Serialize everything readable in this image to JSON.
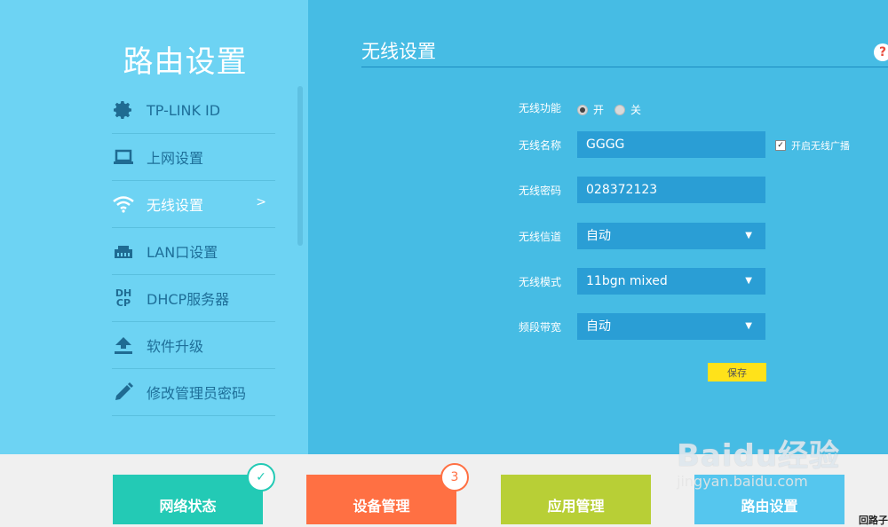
{
  "sidebar": {
    "title": "路由设置",
    "items": [
      {
        "label": "TP-LINK ID",
        "icon": "gear-icon"
      },
      {
        "label": "上网设置",
        "icon": "laptop-icon"
      },
      {
        "label": "无线设置",
        "icon": "wifi-icon",
        "active": true,
        "arrow": ">"
      },
      {
        "label": "LAN口设置",
        "icon": "lan-icon"
      },
      {
        "label": "DHCP服务器",
        "icon": "dhcp-icon",
        "icon_text": "DH CP"
      },
      {
        "label": "软件升级",
        "icon": "upload-icon"
      },
      {
        "label": "修改管理员密码",
        "icon": "pencil-icon"
      }
    ]
  },
  "main": {
    "title": "无线设置",
    "help": "?",
    "form": {
      "wireless_function": {
        "label": "无线功能",
        "on_label": "开",
        "off_label": "关",
        "selected": "开"
      },
      "ssid": {
        "label": "无线名称",
        "value": "GGGG"
      },
      "broadcast": {
        "label": "开启无线广播",
        "checked": true
      },
      "password": {
        "label": "无线密码",
        "value": "028372123"
      },
      "channel": {
        "label": "无线信道",
        "value": "自动"
      },
      "mode": {
        "label": "无线模式",
        "value": "11bgn mixed"
      },
      "bandwidth": {
        "label": "频段带宽",
        "value": "自动"
      },
      "save_label": "保存"
    }
  },
  "bottom_tabs": [
    {
      "label": "网络状态",
      "badge": "✓",
      "color": "#23cab5"
    },
    {
      "label": "设备管理",
      "badge": "3",
      "color": "#ff7043"
    },
    {
      "label": "应用管理",
      "color": "#b8cf36"
    },
    {
      "label": "路由设置",
      "color": "#55c6ee"
    }
  ],
  "watermark": {
    "logo": "Baidu经验",
    "url": "jingyan.baidu.com"
  },
  "corner_text": "回路子"
}
